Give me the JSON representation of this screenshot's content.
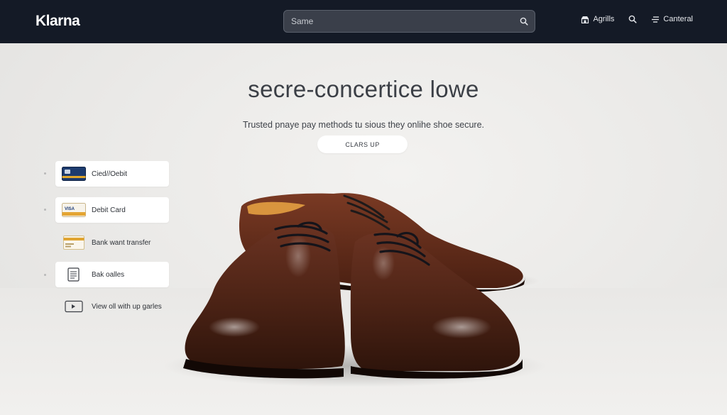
{
  "header": {
    "logo": "Klarna",
    "search_placeholder": "Same",
    "nav": [
      {
        "label": "Agrills",
        "icon": "store-icon"
      },
      {
        "label": "",
        "icon": "search-icon"
      },
      {
        "label": "Canteral",
        "icon": "menu-icon"
      }
    ]
  },
  "hero": {
    "title": "secre-concertice lowe",
    "subtitle": "Trusted pnaye pay methods tu sious they onlihe shoe secure.",
    "cta_label": "CLARS UP"
  },
  "payment_methods": [
    {
      "label": "Cied//Oebit",
      "icon": "credit-card-icon",
      "boxed": true
    },
    {
      "label": "Debit Card",
      "icon": "visa-card-icon",
      "boxed": true
    },
    {
      "label": "Bank want transfer",
      "icon": "bank-transfer-icon",
      "boxed": false
    },
    {
      "label": "Bak oalles",
      "icon": "document-icon",
      "boxed": true
    },
    {
      "label": "View oll with up garles",
      "icon": "play-icon",
      "boxed": false
    }
  ],
  "colors": {
    "header_bg": "#141a26",
    "search_bg": "#3a3f4a",
    "page_bg": "#ecebe9",
    "shoe_brown": "#5a2a1a"
  }
}
